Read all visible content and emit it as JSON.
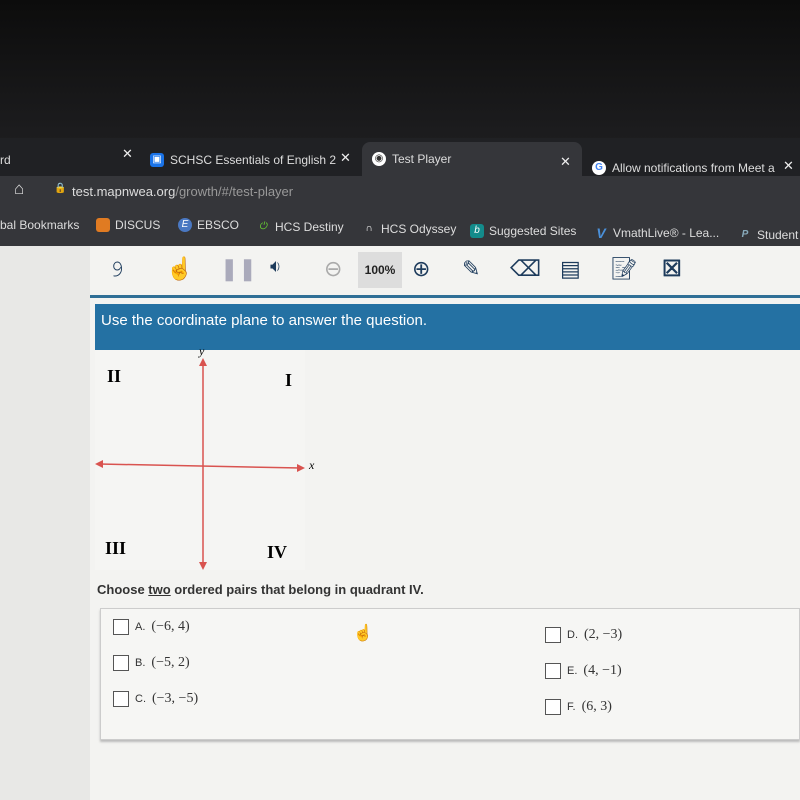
{
  "browser": {
    "tabs": [
      {
        "label": "rd"
      },
      {
        "label": "SCHSC Essentials of English 2"
      },
      {
        "label": "Test Player",
        "active": true
      },
      {
        "label": "Allow notifications from Meet a"
      }
    ],
    "url_host": "test.mapnwea.org",
    "url_path": "/growth/#/test-player",
    "bookmarks": [
      "bal Bookmarks",
      "DISCUS",
      "EBSCO",
      "HCS Destiny",
      "HCS Odyssey",
      "Suggested Sites",
      "VmathLive® - Lea...",
      "Student"
    ]
  },
  "toolbar": {
    "zoom": "100%",
    "tools": [
      "listen-icon",
      "pointer-icon",
      "pause-icon",
      "speaker-icon",
      "zoom-out-icon",
      "zoom-in-icon",
      "highlighter-icon",
      "eraser-icon",
      "line-reader-icon",
      "notepad-icon",
      "answer-eliminator-icon"
    ]
  },
  "banner": "Use the coordinate plane to answer the question.",
  "plane": {
    "y_label": "y",
    "x_label": "x",
    "quadrants": [
      "I",
      "II",
      "III",
      "IV"
    ]
  },
  "question": {
    "pre": "Choose ",
    "em": "two",
    "post": " ordered pairs that belong in quadrant IV."
  },
  "options": [
    {
      "letter": "A.",
      "value": "(−6, 4)"
    },
    {
      "letter": "B.",
      "value": "(−5, 2)"
    },
    {
      "letter": "C.",
      "value": "(−3, −5)"
    },
    {
      "letter": "D.",
      "value": "(2, −3)"
    },
    {
      "letter": "E.",
      "value": "(4, −1)"
    },
    {
      "letter": "F.",
      "value": "(6, 3)"
    }
  ],
  "colors": {
    "banner": "#2471a3",
    "toolbar_icons": "#1d3b5c",
    "axes": "#d9534f"
  }
}
